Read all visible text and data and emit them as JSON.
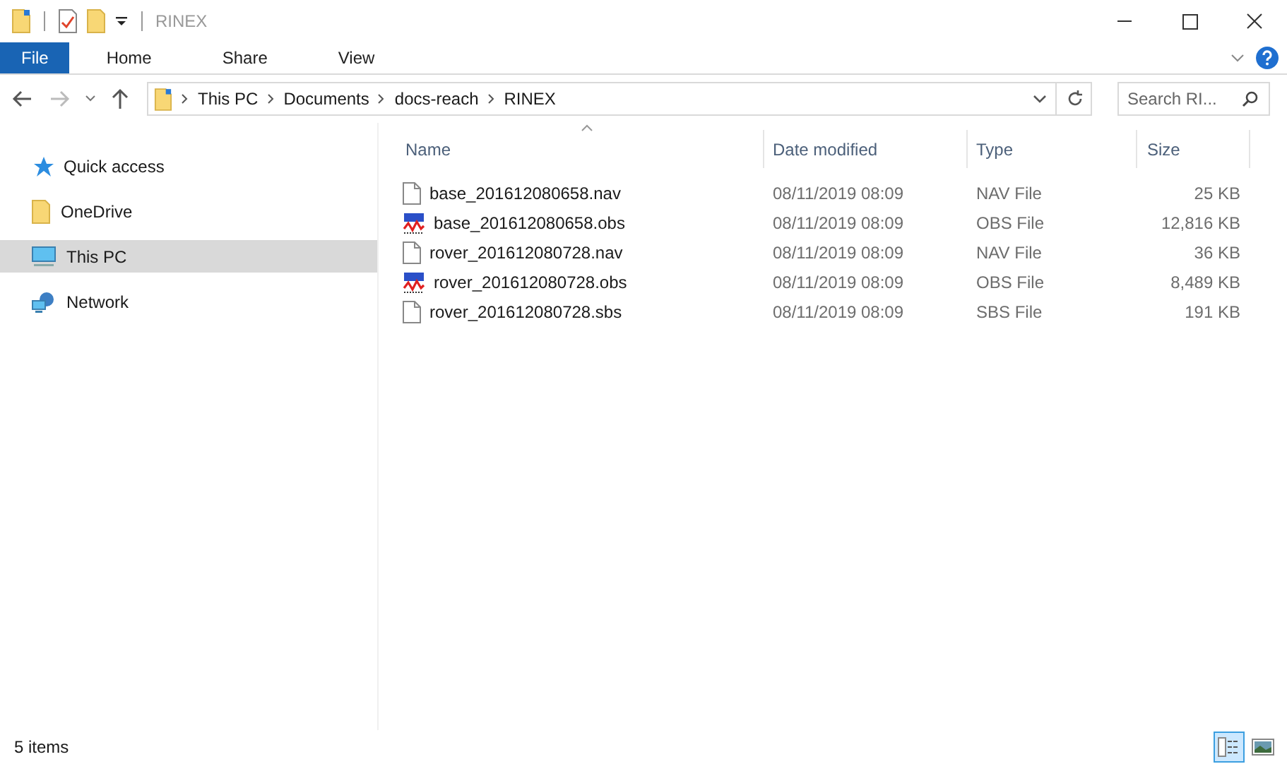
{
  "window": {
    "title": "RINEX"
  },
  "ribbon_tabs": [
    {
      "label": "File",
      "kind": "file",
      "selected": false
    },
    {
      "label": "Home",
      "kind": "tab",
      "selected": false
    },
    {
      "label": "Share",
      "kind": "tab",
      "selected": false
    },
    {
      "label": "View",
      "kind": "tab",
      "selected": false
    }
  ],
  "breadcrumbs": [
    "This PC",
    "Documents",
    "docs-reach",
    "RINEX"
  ],
  "search": {
    "placeholder": "Search RI..."
  },
  "sidebar": {
    "items": [
      {
        "label": "Quick access",
        "kind": "star",
        "selected": false
      },
      {
        "label": "OneDrive",
        "kind": "folder",
        "selected": false
      },
      {
        "label": "This PC",
        "kind": "computer",
        "selected": true
      },
      {
        "label": "Network",
        "kind": "network",
        "selected": false
      }
    ]
  },
  "table": {
    "columns": [
      {
        "label": "Name",
        "sorted": true
      },
      {
        "label": "Date modified",
        "sorted": false
      },
      {
        "label": "Type",
        "sorted": false
      },
      {
        "label": "Size",
        "sorted": false
      }
    ],
    "rows": [
      {
        "name": "base_201612080658.nav",
        "kind": "document",
        "date": "08/11/2019 08:09",
        "type": "NAV File",
        "size": "25 KB"
      },
      {
        "name": "base_201612080658.obs",
        "kind": "program",
        "date": "08/11/2019 08:09",
        "type": "OBS File",
        "size": "12,816 KB"
      },
      {
        "name": "rover_201612080728.nav",
        "kind": "document",
        "date": "08/11/2019 08:09",
        "type": "NAV File",
        "size": "36 KB"
      },
      {
        "name": "rover_201612080728.obs",
        "kind": "program",
        "date": "08/11/2019 08:09",
        "type": "OBS File",
        "size": "8,489 KB"
      },
      {
        "name": "rover_201612080728.sbs",
        "kind": "document",
        "date": "08/11/2019 08:09",
        "type": "SBS File",
        "size": "191 KB"
      }
    ]
  },
  "status_bar": {
    "count": "5 items",
    "views": [
      {
        "kind": "details",
        "selected": true
      },
      {
        "kind": "tiles",
        "selected": false
      }
    ]
  }
}
